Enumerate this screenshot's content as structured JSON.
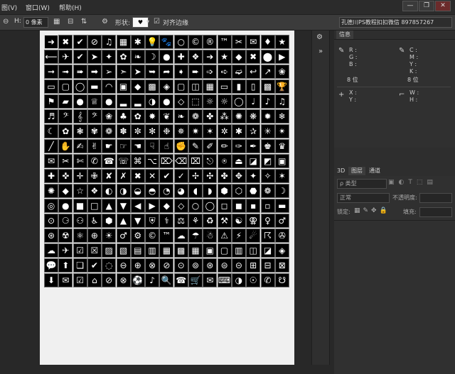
{
  "menubar": {
    "items": [
      "图(V)",
      "窗口(W)",
      "帮助(H)"
    ],
    "min": "—",
    "restore": "❐",
    "close": "✕"
  },
  "options": {
    "h_label": "H:",
    "h_value": "0 像素",
    "shape_label": "形状:",
    "align_edges": "对齐边缘",
    "doc_title": "孔德川PS教程扣扣微信 897857267"
  },
  "info_panel": {
    "tab": "信息",
    "rgb_labels": [
      "R :",
      "G :",
      "B :"
    ],
    "cmyk_labels": [
      "C :",
      "M :",
      "Y :",
      "K :"
    ],
    "bit_left": "8 位",
    "bit_right": "8 位",
    "xy_labels": [
      "X :",
      "Y :"
    ],
    "wh_labels": [
      "W :",
      "H :"
    ]
  },
  "layers_panel": {
    "tabs": [
      "3D",
      "图层",
      "通道"
    ],
    "filter": "ρ 类型",
    "blend": "正常",
    "opacity": "不透明度:",
    "lock": "锁定:",
    "fill": "填充:"
  },
  "shapes": {
    "selected": 0,
    "symbols": [
      "➜",
      "✖",
      "✔",
      "⊘",
      "♫",
      "▦",
      "✱",
      "💡",
      "🐾",
      "○",
      "©",
      "®",
      "™",
      "✂",
      "✉",
      "♦",
      "★",
      "⟵",
      "✈",
      "✔",
      "➤",
      "✦",
      "✿",
      "❧",
      "☽",
      "●",
      "✚",
      "❖",
      "➔",
      "★",
      "◆",
      "✖",
      "⬤",
      "▶",
      "➞",
      "➟",
      "➠",
      "➡",
      "➢",
      "➣",
      "➤",
      "➥",
      "➦",
      "➧",
      "➨",
      "➩",
      "➪",
      "➫",
      "↩",
      "↗",
      "❀",
      "▭",
      "▢",
      "◯",
      "▬",
      "◠",
      "▣",
      "◆",
      "▩",
      "◈",
      "▢",
      "◫",
      "▦",
      "▭",
      "▮",
      "▯",
      "▩",
      "🏆",
      "⚑",
      "▰",
      "●",
      "♕",
      "●",
      "▂",
      "▂",
      "◑",
      "●",
      "◇",
      "⬚",
      "☼",
      "☼",
      "◯",
      "♩",
      "♪",
      "♫",
      "♬",
      "𝄢",
      "𝄞",
      "𝄢",
      "❀",
      "♣",
      "✿",
      "✸",
      "❦",
      "❧",
      "❁",
      "✤",
      "⁂",
      "✺",
      "❋",
      "✹",
      "❄",
      "☾",
      "✿",
      "❃",
      "✾",
      "❁",
      "✽",
      "✼",
      "✻",
      "❉",
      "✵",
      "✷",
      "✶",
      "✲",
      "✱",
      "✰",
      "✳",
      "✴",
      "╱",
      "✋",
      "✍",
      "✌",
      "☛",
      "☞",
      "☚",
      "☟",
      "☝",
      "✊",
      "✎",
      "✐",
      "✏",
      "✑",
      "✒",
      "♚",
      "♛",
      "✉",
      "✂",
      "✄",
      "✆",
      "☎",
      "☏",
      "⌘",
      "⌥",
      "⌦",
      "⌫",
      "⌧",
      "⎋",
      "⍟",
      "⏏",
      "◪",
      "◩",
      "▣",
      "✚",
      "✜",
      "✛",
      "✙",
      "✘",
      "✗",
      "✖",
      "✕",
      "✔",
      "✓",
      "✢",
      "✣",
      "✤",
      "✥",
      "✦",
      "✧",
      "✶",
      "✺",
      "◆",
      "☆",
      "❖",
      "◐",
      "◑",
      "◒",
      "◓",
      "◔",
      "◕",
      "◖",
      "◗",
      "⬢",
      "⬡",
      "⬣",
      "❁",
      "☽",
      "◎",
      "●",
      "■",
      "□",
      "▲",
      "▼",
      "◀",
      "▶",
      "◆",
      "◇",
      "○",
      "◯",
      "◻",
      "◼",
      "▪",
      "▫",
      "▬",
      "⊙",
      "⚆",
      "⚇",
      "♿",
      "⬢",
      "▲",
      "▼",
      "⛨",
      "⚕",
      "⚖",
      "⚘",
      "♻",
      "⚒",
      "☯",
      "⚢",
      "♀",
      "♂",
      "⊛",
      "☢",
      "⚛",
      "⊕",
      "☀",
      "♂",
      "⚙",
      "©",
      "™",
      "☁",
      "☂",
      "☃",
      "⚠",
      "⚡",
      "☄",
      "☈",
      "✇",
      "☁",
      "✈",
      "☑",
      "☒",
      "▨",
      "▧",
      "▤",
      "▥",
      "▦",
      "▩",
      "▦",
      "▣",
      "▢",
      "▥",
      "◫",
      "◪",
      "◈",
      "💬",
      "⬆",
      "❏",
      "✔",
      "◌",
      "⊖",
      "⊕",
      "⊗",
      "⊘",
      "⊙",
      "⊚",
      "⊛",
      "⊜",
      "⊝",
      "⊞",
      "⊟",
      "⊠",
      "⬇",
      "✉",
      "☑",
      "⌂",
      "⊘",
      "⊗",
      "⚽",
      "♪",
      "🔍",
      "☎",
      "🛒",
      "✉",
      "⌨",
      "◑",
      "☉",
      "✆",
      "☋"
    ]
  }
}
